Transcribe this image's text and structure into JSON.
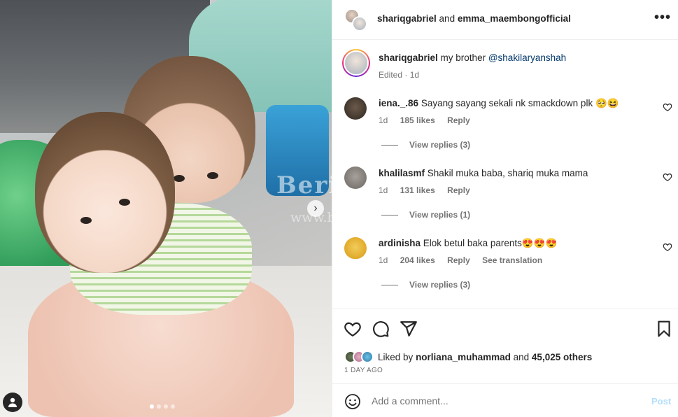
{
  "header": {
    "user1": "shariqgabriel",
    "joiner": "and",
    "user2": "emma_maembongofficial",
    "more_icon": "more-horizontal-icon"
  },
  "caption": {
    "username": "shariqgabriel",
    "text": "my brother",
    "mention": "@shakilaryanshah",
    "edited": "Edited",
    "time": "1d"
  },
  "comments": [
    {
      "username": "iena._.86",
      "text": "Sayang sayang sekali nk smackdown plk 🥺😆",
      "time": "1d",
      "likes": "185 likes",
      "reply": "Reply",
      "view_replies": "View replies (3)"
    },
    {
      "username": "khalilasmf",
      "text": "Shakil muka baba, shariq muka mama",
      "time": "1d",
      "likes": "131 likes",
      "reply": "Reply",
      "view_replies": "View replies (1)"
    },
    {
      "username": "ardinisha",
      "text": "Elok betul baka parents😍😍😍",
      "time": "1d",
      "likes": "204 likes",
      "reply": "Reply",
      "translation": "See translation",
      "view_replies": "View replies (3)"
    }
  ],
  "likes": {
    "prefix": "Liked by",
    "user": "norliana_muhammad",
    "and": "and",
    "others": "45,025 others"
  },
  "timestamp": "1 DAY AGO",
  "add_comment": {
    "placeholder": "Add a comment...",
    "post_label": "Post"
  },
  "watermark": {
    "line1": "Berita Kopak",
    "line2": "www.beritakopak.com"
  },
  "colors": {
    "mention": "#00376b",
    "secondary": "#737373",
    "post_disabled": "#b2dffc"
  },
  "carousel": {
    "total": 4,
    "active": 1
  }
}
